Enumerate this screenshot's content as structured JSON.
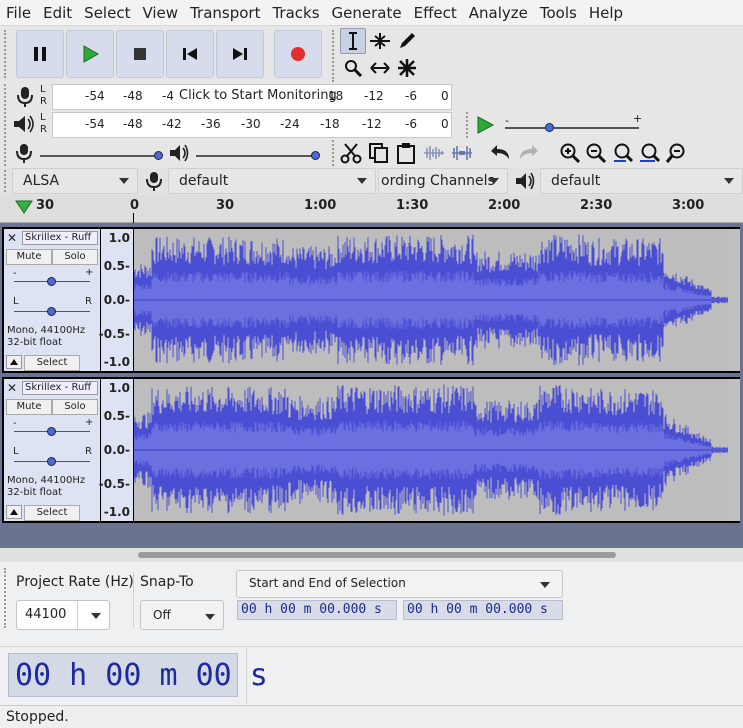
{
  "menu": [
    "File",
    "Edit",
    "Select",
    "View",
    "Transport",
    "Tracks",
    "Generate",
    "Effect",
    "Analyze",
    "Tools",
    "Help"
  ],
  "transport": {
    "pause_label": "Pause",
    "play_label": "Play",
    "stop_label": "Stop",
    "skip_start_label": "Skip to Start",
    "skip_end_label": "Skip to End",
    "record_label": "Record"
  },
  "meters": {
    "rec_ticks": [
      "-54",
      "-48",
      "-4",
      "Click to Start Monitoring",
      "18",
      "-12",
      "-6",
      "0"
    ],
    "play_ticks": [
      "-54",
      "-48",
      "-42",
      "-36",
      "-30",
      "-24",
      "-18",
      "-12",
      "-6",
      "0"
    ],
    "l": "L",
    "r": "R"
  },
  "devices": {
    "host": "ALSA",
    "rec_device": "default",
    "channels": "ording Channels",
    "play_device": "default"
  },
  "ruler": {
    "ticks": [
      "30",
      "0",
      "30",
      "1:00",
      "1:30",
      "2:00",
      "2:30",
      "3:00"
    ]
  },
  "tracks": [
    {
      "name": "Skrillex - Ruff",
      "mute": "Mute",
      "solo": "Solo",
      "plus": "+",
      "minus": "-",
      "pan_l": "L",
      "pan_r": "R",
      "format": "Mono, 44100Hz",
      "bitdepth": "32-bit float",
      "select": "Select",
      "scale": [
        "1.0",
        "0.5-",
        "0.0-",
        "-0.5-",
        "-1.0"
      ]
    },
    {
      "name": "Skrillex - Ruff",
      "mute": "Mute",
      "solo": "Solo",
      "plus": "+",
      "minus": "-",
      "pan_l": "L",
      "pan_r": "R",
      "format": "Mono, 44100Hz",
      "bitdepth": "32-bit float",
      "select": "Select",
      "scale": [
        "1.0",
        "0.5-",
        "0.0-",
        "-0.5-",
        "-1.0"
      ]
    }
  ],
  "bottom": {
    "project_rate_label": "Project Rate (Hz)",
    "project_rate": "44100",
    "snap_to_label": "Snap-To",
    "snap_to": "Off",
    "selection_mode": "Start and End of Selection",
    "sel_start": "00 h 00 m 00.000 s",
    "sel_end": "00 h 00 m 00.000 s",
    "big_time": "00 h 00 m 00 s"
  },
  "status": "Stopped.",
  "colors": {
    "waveform": "#4a4ed2",
    "record": "#e03030",
    "play": "#2eaa3a",
    "time_text": "#1e2aa0"
  }
}
